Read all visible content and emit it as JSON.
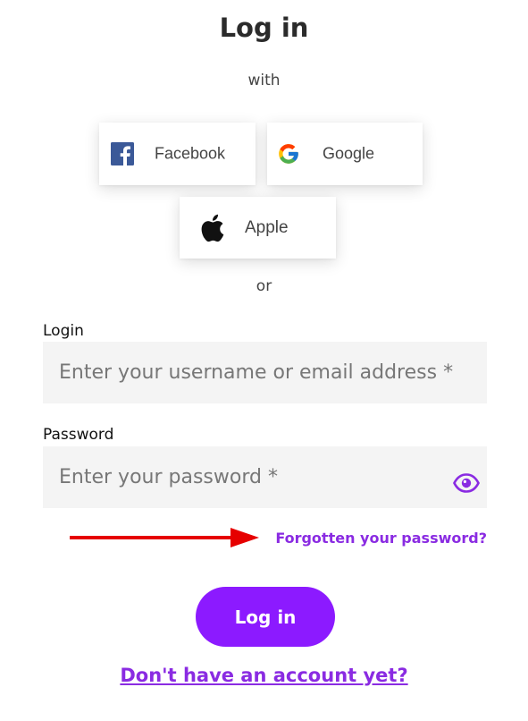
{
  "header": {
    "title": "Log in",
    "with_label": "with"
  },
  "social": {
    "facebook_label": "Facebook",
    "google_label": "Google",
    "apple_label": "Apple"
  },
  "divider_label": "or",
  "form": {
    "login_label": "Login",
    "login_placeholder": "Enter your username or email address *",
    "password_label": "Password",
    "password_placeholder": "Enter your password *",
    "show_password_icon": "eye-icon",
    "forgot_link": "Forgotten your password?",
    "submit_label": "Log in",
    "signup_link": "Don't have an account yet?"
  },
  "annotation": {
    "arrow_icon": "arrow-right-icon",
    "arrow_color": "#e60000"
  },
  "colors": {
    "accent": "#8c1aff",
    "link": "#8a2be2",
    "input_bg": "#f4f4f4"
  }
}
